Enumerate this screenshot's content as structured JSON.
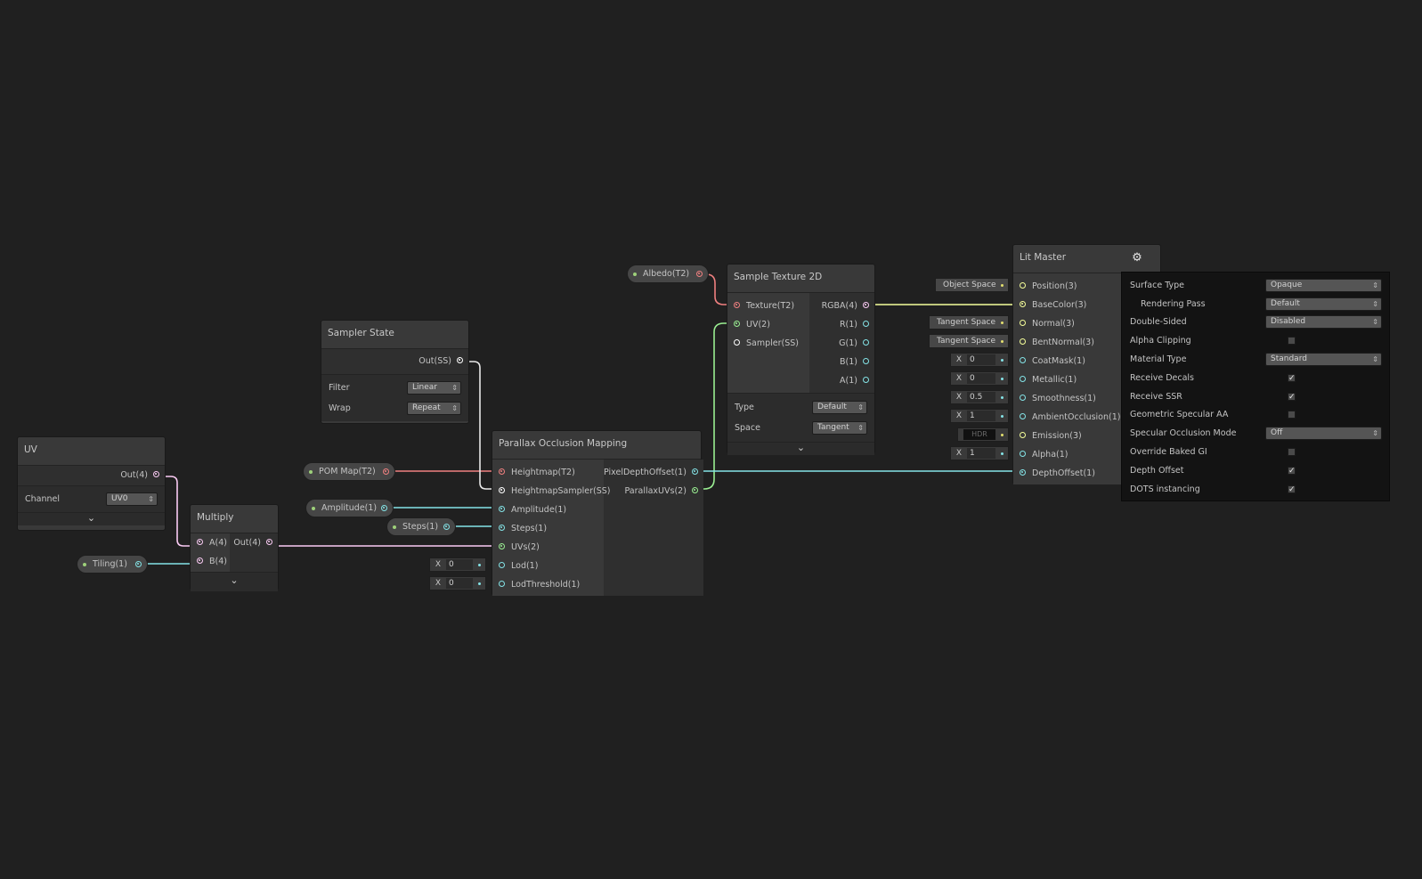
{
  "nodes": {
    "uv": {
      "title": "UV",
      "out": "Out(4)",
      "channel_label": "Channel",
      "channel_value": "UV0"
    },
    "multiply": {
      "title": "Multiply",
      "in_a": "A(4)",
      "in_b": "B(4)",
      "out": "Out(4)"
    },
    "sampler_state": {
      "title": "Sampler State",
      "out": "Out(SS)",
      "filter_label": "Filter",
      "filter_value": "Linear",
      "wrap_label": "Wrap",
      "wrap_value": "Repeat"
    },
    "pom": {
      "title": "Parallax Occlusion Mapping",
      "inputs": [
        "Heightmap(T2)",
        "HeightmapSampler(SS)",
        "Amplitude(1)",
        "Steps(1)",
        "UVs(2)",
        "Lod(1)",
        "LodThreshold(1)"
      ],
      "outputs": [
        "PixelDepthOffset(1)",
        "ParallaxUVs(2)"
      ],
      "lod_value": "0",
      "lod_threshold_value": "0"
    },
    "sample_texture": {
      "title": "Sample Texture 2D",
      "inputs": [
        "Texture(T2)",
        "UV(2)",
        "Sampler(SS)"
      ],
      "outputs": [
        "RGBA(4)",
        "R(1)",
        "G(1)",
        "B(1)",
        "A(1)"
      ],
      "type_label": "Type",
      "type_value": "Default",
      "space_label": "Space",
      "space_value": "Tangent"
    },
    "lit_master": {
      "title": "Lit Master",
      "inputs": [
        "Position(3)",
        "BaseColor(3)",
        "Normal(3)",
        "BentNormal(3)",
        "CoatMask(1)",
        "Metallic(1)",
        "Smoothness(1)",
        "AmbientOcclusion(1)",
        "Emission(3)",
        "Alpha(1)",
        "DepthOffset(1)"
      ],
      "position_space": "Object Space",
      "normal_space": "Tangent Space",
      "bentnormal_space": "Tangent Space",
      "coatmask_value": "0",
      "metallic_value": "0",
      "smoothness_value": "0.5",
      "ao_value": "1",
      "emission_hdr": "HDR",
      "alpha_value": "1"
    }
  },
  "properties": {
    "albedo": "Albedo(T2)",
    "pom_map": "POM Map(T2)",
    "amplitude": "Amplitude(1)",
    "steps": "Steps(1)",
    "tiling": "Tiling(1)"
  },
  "field_axis_label": "X",
  "settings_panel": {
    "surface_type": {
      "label": "Surface Type",
      "value": "Opaque"
    },
    "rendering_pass": {
      "label": "Rendering Pass",
      "value": "Default"
    },
    "double_sided": {
      "label": "Double-Sided",
      "value": "Disabled"
    },
    "alpha_clipping": {
      "label": "Alpha Clipping",
      "checked": false
    },
    "material_type": {
      "label": "Material Type",
      "value": "Standard"
    },
    "receive_decals": {
      "label": "Receive Decals",
      "checked": true
    },
    "receive_ssr": {
      "label": "Receive SSR",
      "checked": true
    },
    "geometric_specular_aa": {
      "label": "Geometric Specular AA",
      "checked": false
    },
    "specular_occlusion_mode": {
      "label": "Specular Occlusion Mode",
      "value": "Off"
    },
    "override_baked_gi": {
      "label": "Override Baked GI",
      "checked": false
    },
    "depth_offset": {
      "label": "Depth Offset",
      "checked": true
    },
    "dots_instancing": {
      "label": "DOTS instancing",
      "checked": true
    }
  },
  "icons": {
    "gear": "gear-icon",
    "expand": "chevron-down-icon",
    "check": "checkmark-icon"
  },
  "colors": {
    "background": "#202020",
    "node": "#393939",
    "texture_port": "#f08080",
    "vector1_port": "#84e4e7",
    "vector2_port": "#9aef92",
    "vector3_port": "#f6ff9a",
    "vector4_port": "#fbcbf4",
    "sampler_port": "#ffffff"
  }
}
